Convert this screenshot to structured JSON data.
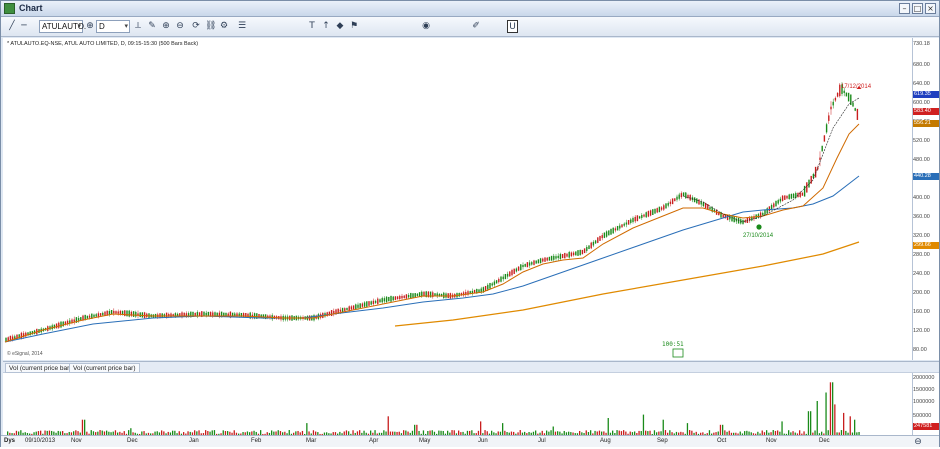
{
  "window": {
    "title": "Chart"
  },
  "toolbar": {
    "symbol": "ATULAUTO.",
    "interval": "D",
    "buttons": [
      "line-tool",
      "trend-tool",
      "crosshair-tool",
      "text-tool",
      "arrow-tool",
      "zoom-in",
      "zoom-out",
      "refresh",
      "settings"
    ]
  },
  "chart": {
    "info": "* ATULAUTO.EQ-NSE, ATUL AUTO LIMITED, D, 09:15-15:30 (500 Bars Back)",
    "watermark": "© eSignal, 2014",
    "price_ticks": [
      "730.18",
      "680.00",
      "640.00",
      "600.00",
      "560.00",
      "520.00",
      "480.00",
      "440.00",
      "400.00",
      "360.00",
      "320.00",
      "280.00",
      "240.00",
      "200.00",
      "160.00",
      "120.00",
      "80.00"
    ],
    "price_tags": [
      {
        "label": "619.35",
        "color": "#1f3fbf"
      },
      {
        "label": "583.40",
        "color": "#d02020"
      },
      {
        "label": "556.21",
        "color": "#c47a00"
      },
      {
        "label": "440.28",
        "color": "#2a6fb8"
      },
      {
        "label": "299.66",
        "color": "#e08a00"
      }
    ],
    "annotations": [
      "17/12/2014",
      "27/10/2014",
      "100:51"
    ],
    "vol_tabs": [
      "Vol (current price bar)",
      "Vol (current price bar)"
    ],
    "vol_ticks": [
      "2000000",
      "1500000",
      "1000000",
      "500000"
    ],
    "vol_tag": "247581",
    "time_axis": {
      "left_label": "Dys",
      "start_date": "09/10/2013",
      "months": [
        "Nov",
        "Dec",
        "Jan",
        "Feb",
        "Mar",
        "Apr",
        "May",
        "Jun",
        "Jul",
        "Aug",
        "Sep",
        "Oct",
        "Nov",
        "Dec"
      ]
    }
  },
  "colors": {
    "up": "#1a8a1a",
    "down": "#c81e1e",
    "ma_short": "#d06a00",
    "ma_mid": "#2a6fb8",
    "ma_long": "#e08a00"
  }
}
